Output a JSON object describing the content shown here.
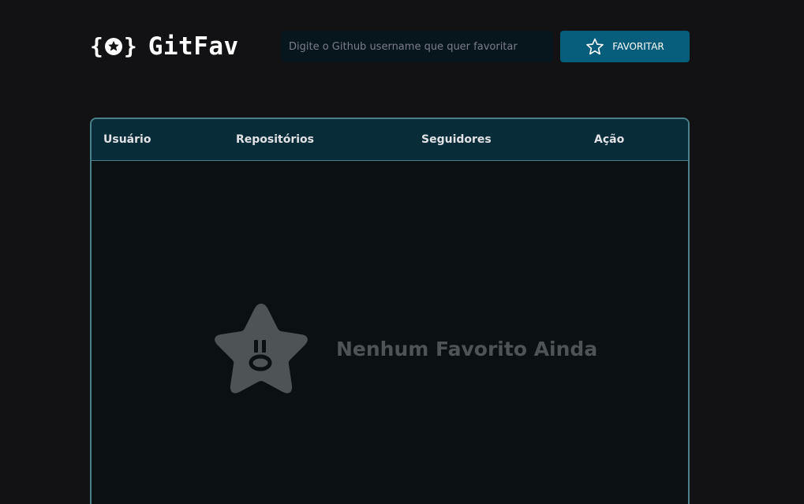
{
  "header": {
    "logo_text": "GitFav",
    "search_placeholder": "Digite o Github username que quer favoritar",
    "favorite_button_label": "FAVORITAR"
  },
  "table": {
    "columns": [
      "Usuário",
      "Repositórios",
      "Seguidores",
      "Ação"
    ],
    "rows": []
  },
  "empty_state": {
    "message": "Nenhum Favorito Ainda",
    "icon": "sad-star-icon"
  },
  "colors": {
    "background": "#121214",
    "button": "#065e7c",
    "table_header": "#092d38",
    "table_border": "#4a808c",
    "empty_text": "#4e5455"
  }
}
